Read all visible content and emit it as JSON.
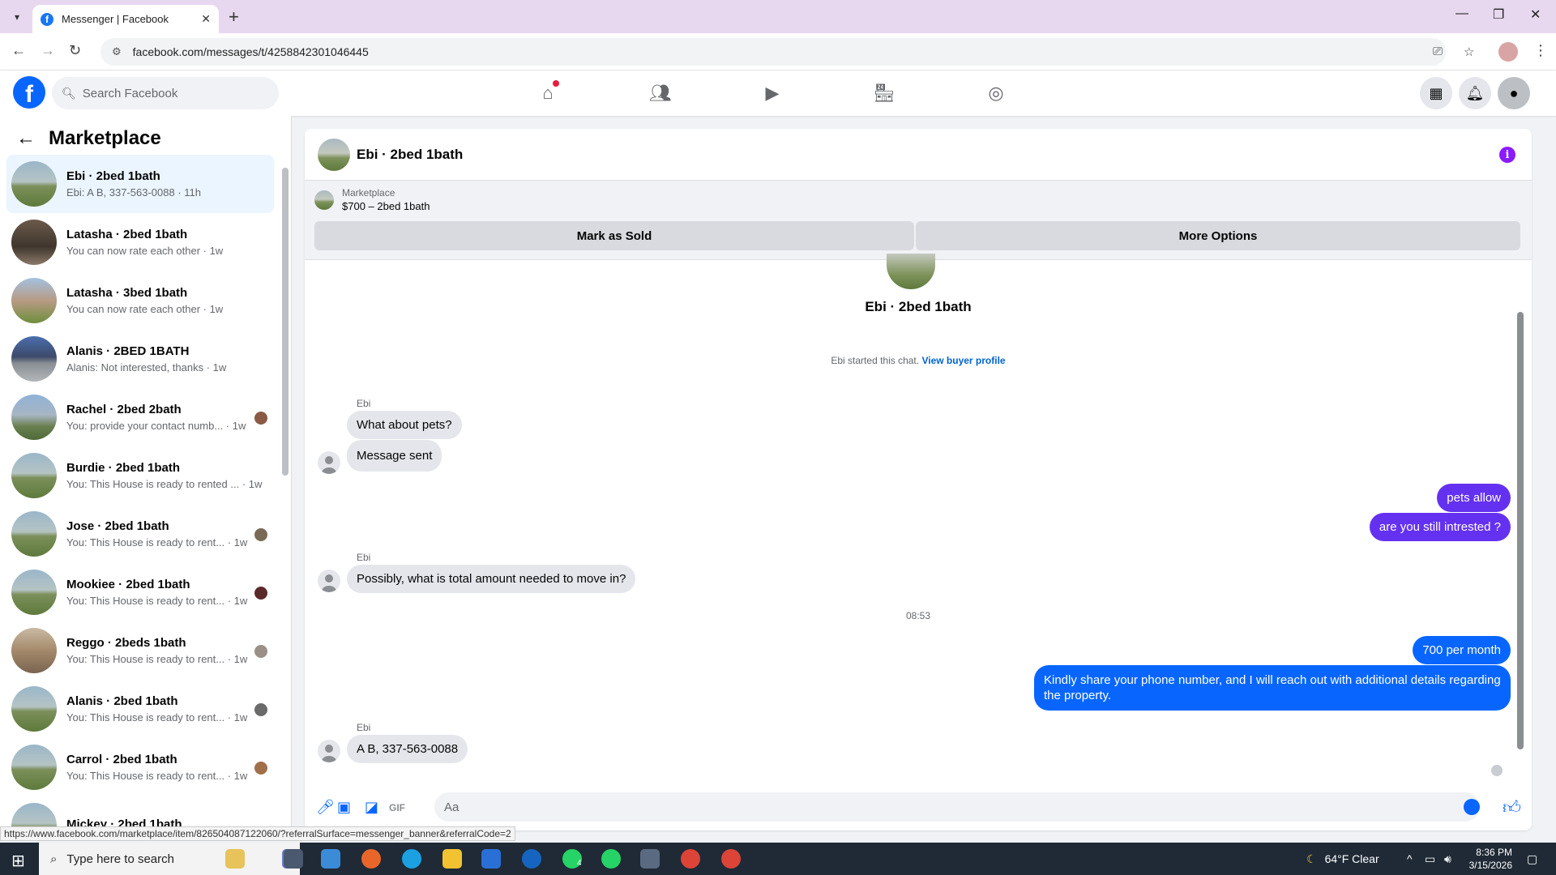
{
  "browser": {
    "tab_title": "Messenger | Facebook",
    "url": "facebook.com/messages/t/4258842301046445",
    "status_url": "https://www.facebook.com/marketplace/item/826504087122060/?referralSurface=messenger_banner&referralCode=2"
  },
  "header": {
    "search_placeholder": "Search Facebook",
    "logo": "f"
  },
  "sidebar": {
    "title": "Marketplace",
    "conversations": [
      {
        "name": "Ebi · 2bed 1bath",
        "preview": "Ebi: A B, 337-563-0088 · 11h",
        "active": true
      },
      {
        "name": "Latasha · 2bed 1bath",
        "preview": "You can now rate each other · 1w"
      },
      {
        "name": "Latasha · 3bed 1bath",
        "preview": "You can now rate each other · 1w"
      },
      {
        "name": "Alanis · 2BED 1BATH",
        "preview": "Alanis: Not interested, thanks · 1w"
      },
      {
        "name": "Rachel · 2bed 2bath",
        "preview": "You: provide your contact numb... · 1w"
      },
      {
        "name": "Burdie · 2bed 1bath",
        "preview": "You: This House is ready to rented ... · 1w"
      },
      {
        "name": "Jose · 2bed 1bath",
        "preview": "You: This House is ready to rent... · 1w"
      },
      {
        "name": "Mookiee · 2bed 1bath",
        "preview": "You: This House is ready to rent... · 1w"
      },
      {
        "name": "Reggo · 2beds 1bath",
        "preview": "You: This House is ready to rent... · 1w"
      },
      {
        "name": "Alanis · 2bed 1bath",
        "preview": "You: This House is ready to rent... · 1w"
      },
      {
        "name": "Carrol · 2bed 1bath",
        "preview": "You: This House is ready to rent... · 1w"
      },
      {
        "name": "Mickey · 2bed 1bath",
        "preview": ""
      }
    ]
  },
  "chat": {
    "title": "Ebi · 2bed 1bath",
    "marketplace_label": "Marketplace",
    "listing": "$700 – 2bed 1bath",
    "mark_sold": "Mark as Sold",
    "more_options": "More Options",
    "intro_name": "Ebi · 2bed 1bath",
    "started_text": "Ebi started this chat.",
    "buyer_link": "View buyer profile",
    "sender": "Ebi",
    "msg_in_1": "What about pets?",
    "msg_in_2": "Message sent",
    "msg_out_1": "pets allow",
    "msg_out_2": "are you still intrested ?",
    "msg_in_3": "Possibly, what is total amount needed to move in?",
    "time_1": "08:53",
    "msg_out_3": "700 per month",
    "msg_out_4": "Kindly share your phone number, and I will reach out with additional details regarding the property.",
    "msg_in_4": "A B, 337-563-0088",
    "composer_placeholder": "Aa"
  },
  "taskbar": {
    "search_placeholder": "Type here to search",
    "weather": "64°F  Clear",
    "time": "8:36 PM",
    "date": "3/15/2026",
    "whatsapp_badge": "4"
  }
}
